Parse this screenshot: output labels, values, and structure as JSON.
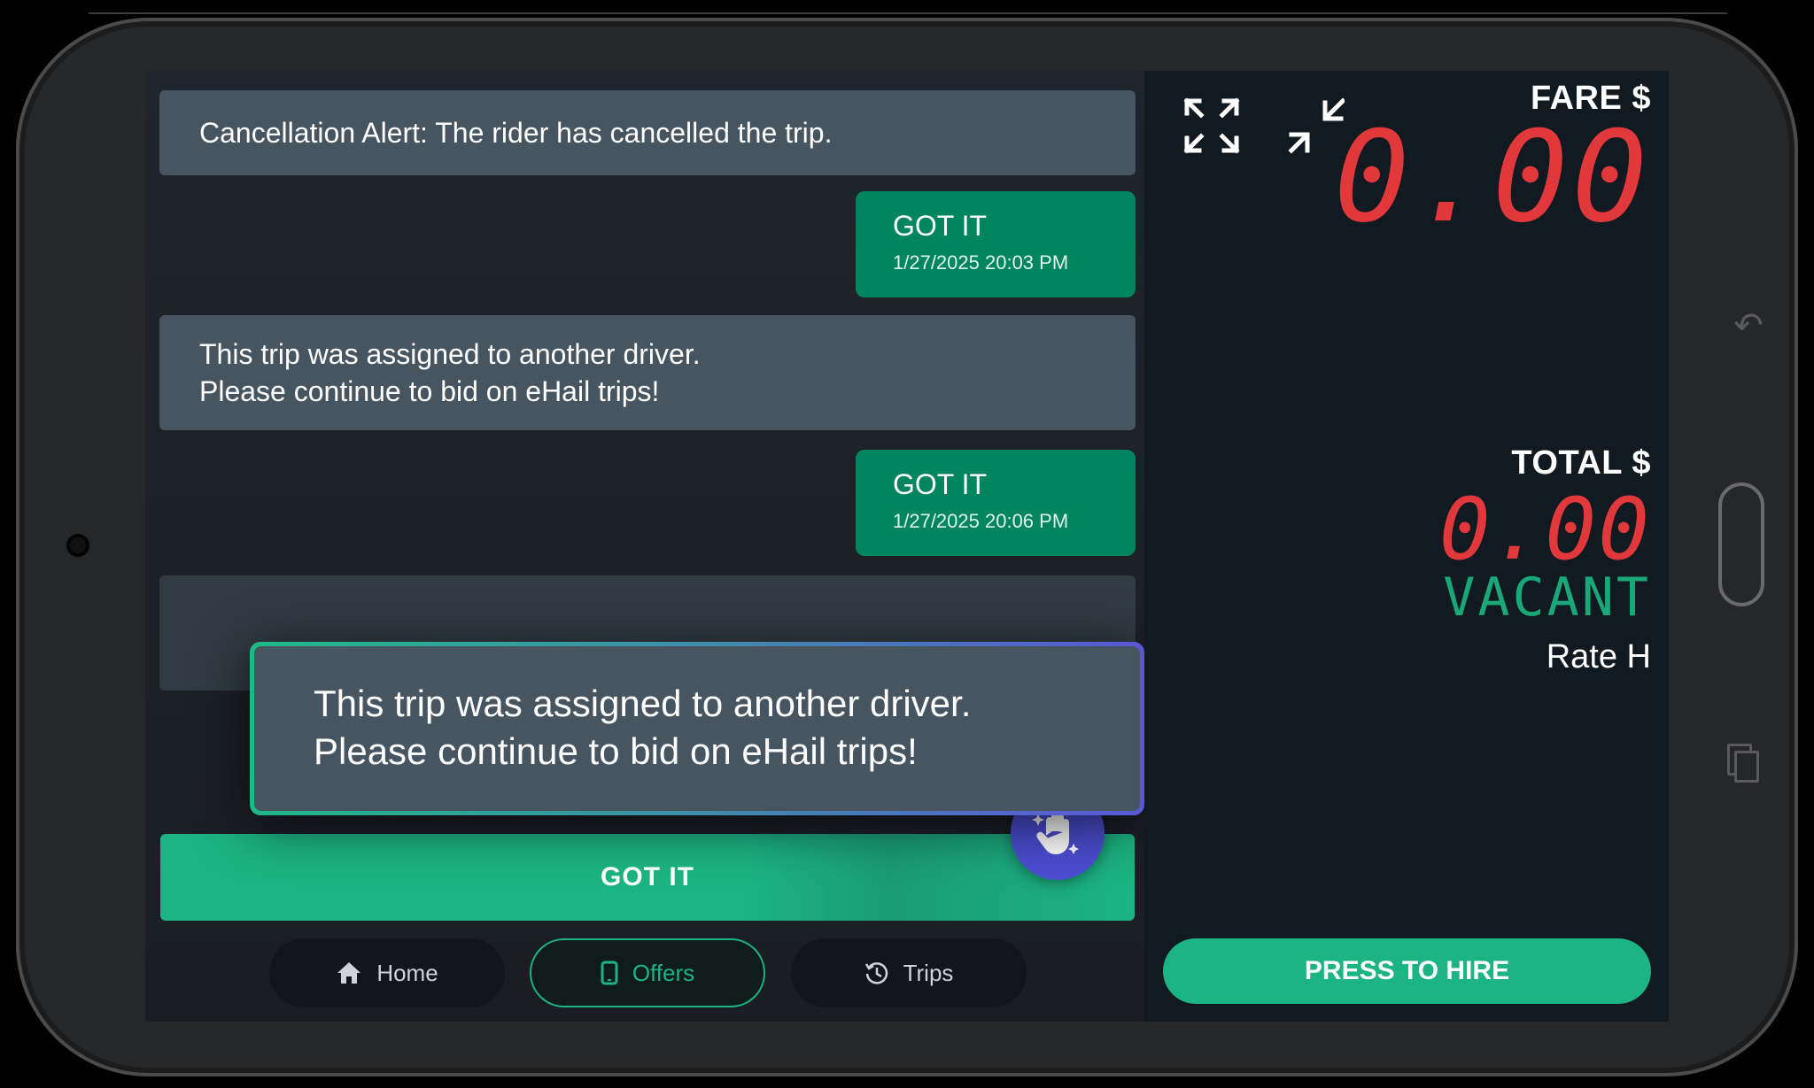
{
  "messages": [
    {
      "type": "incoming",
      "lines": [
        "Cancellation Alert: The rider has cancelled the trip."
      ]
    },
    {
      "type": "reply",
      "text": "GOT IT",
      "timestamp": "1/27/2025 20:03 PM"
    },
    {
      "type": "incoming",
      "lines": [
        "This trip was assigned to another driver.",
        "Please continue to bid on eHail trips!"
      ]
    },
    {
      "type": "reply",
      "text": "GOT IT",
      "timestamp": "1/27/2025 20:06 PM"
    }
  ],
  "toast": {
    "line1": "This trip was assigned to another driver.",
    "line2": "Please continue to bid on eHail trips!"
  },
  "primary_action": {
    "label": "GOT IT"
  },
  "fab": {
    "icon": "hand-sparkle-icon"
  },
  "nav": [
    {
      "label": "Home",
      "icon": "home-icon",
      "active": false
    },
    {
      "label": "Offers",
      "icon": "phone-icon",
      "active": true
    },
    {
      "label": "Trips",
      "icon": "history-icon",
      "active": false
    }
  ],
  "meter": {
    "fare_label": "FARE $",
    "fare_value": "0.00",
    "total_label": "TOTAL $",
    "total_value": "0.00",
    "status": "VACANT",
    "rate": "Rate H",
    "hire_button": "PRESS TO HIRE"
  },
  "icons": {
    "expand": "expand-icon",
    "collapse": "collapse-icon"
  },
  "colors": {
    "accent": "#1cb482",
    "reply_bubble": "#00855f",
    "incoming_bubble": "#465560",
    "meter_digits": "#e0383b",
    "vacant": "#1aa878",
    "fab": "#4c4dd1"
  }
}
